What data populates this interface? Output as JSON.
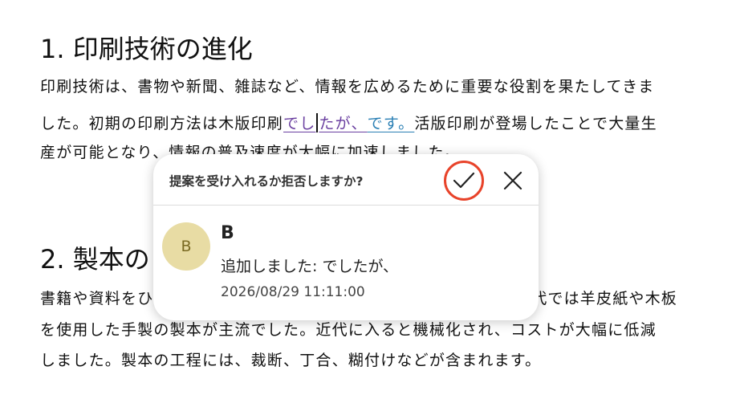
{
  "section1": {
    "heading": "1. 印刷技術の進化",
    "line1": "印刷技術は、書物や新聞、雑誌など、情報を広めるために重要な役割を果たしてきま",
    "line2_a": "した。初期の印刷方法は木版印刷",
    "line2_ins1a": "でし",
    "line2_ins1b": "たが、",
    "line2_ins2": "です。",
    "line2_b": "活版印刷が登場したことで大量生",
    "line3": "産が可能となり、情報の普及速度が大幅に加速しました。"
  },
  "section2": {
    "heading": "2. 製本の",
    "line1_a": "書籍や資料をひ",
    "line1_b": "古代では羊皮紙や木板",
    "line2": "を使用した手製の製本が主流でした。近代に入ると機械化され、コストが大幅に低減",
    "line3": "しました。製本の工程には、裁断、丁合、糊付けなどが含まれます。"
  },
  "popup": {
    "prompt": "提案を受け入れるか拒否しますか?",
    "accept_icon": "check-icon",
    "reject_icon": "close-icon",
    "avatar_initial": "B",
    "author": "B",
    "change": "追加しました: でしたが、",
    "timestamp": "2026/08/29 11:11:00"
  },
  "colors": {
    "insertion_purple": "#6a3fa0",
    "insertion_blue": "#2a7fb4",
    "accept_ring": "#e8432a",
    "avatar_bg": "#e8dca4"
  }
}
